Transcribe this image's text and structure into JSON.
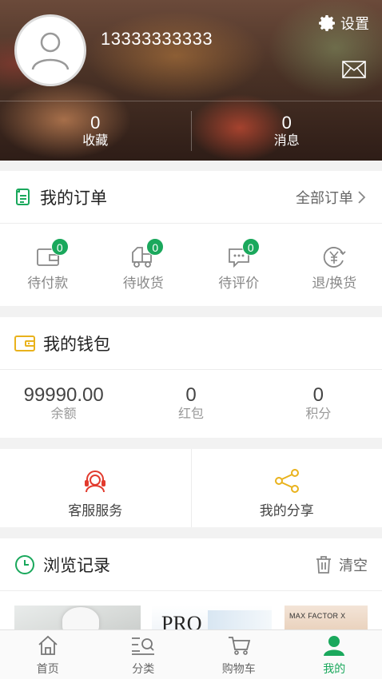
{
  "profile": {
    "phone": "13333333333"
  },
  "header": {
    "settings_label": "设置"
  },
  "stats": [
    {
      "value": "0",
      "label": "收藏"
    },
    {
      "value": "0",
      "label": "消息"
    }
  ],
  "orders": {
    "title": "我的订单",
    "all_label": "全部订单",
    "items": [
      {
        "label": "待付款",
        "badge": "0",
        "icon": "wallet-payment-icon"
      },
      {
        "label": "待收货",
        "badge": "0",
        "icon": "delivery-truck-icon"
      },
      {
        "label": "待评价",
        "badge": "0",
        "icon": "comment-icon"
      },
      {
        "label": "退/换货",
        "icon": "yen-refund-icon"
      }
    ]
  },
  "wallet": {
    "title": "我的钱包",
    "items": [
      {
        "value": "99990.00",
        "label": "余额"
      },
      {
        "value": "0",
        "label": "红包"
      },
      {
        "value": "0",
        "label": "积分"
      }
    ]
  },
  "services": [
    {
      "label": "客服服务",
      "icon": "headset-icon"
    },
    {
      "label": "我的分享",
      "icon": "share-icon"
    }
  ],
  "history": {
    "title": "浏览记录",
    "clear_label": "清空",
    "thumbs": [
      {
        "name": "product-thumb-1"
      },
      {
        "name": "product-thumb-2",
        "brand": "PRO"
      },
      {
        "name": "product-thumb-3",
        "brand": "MAX FACTOR X"
      }
    ]
  },
  "tabbar": [
    {
      "label": "首页",
      "icon": "home-icon"
    },
    {
      "label": "分类",
      "icon": "category-search-icon"
    },
    {
      "label": "购物车",
      "icon": "cart-icon"
    },
    {
      "label": "我的",
      "icon": "user-icon",
      "active": true
    }
  ],
  "colors": {
    "accent": "#1aa85c",
    "red": "#e23b2e",
    "yellow": "#e9b21c"
  }
}
